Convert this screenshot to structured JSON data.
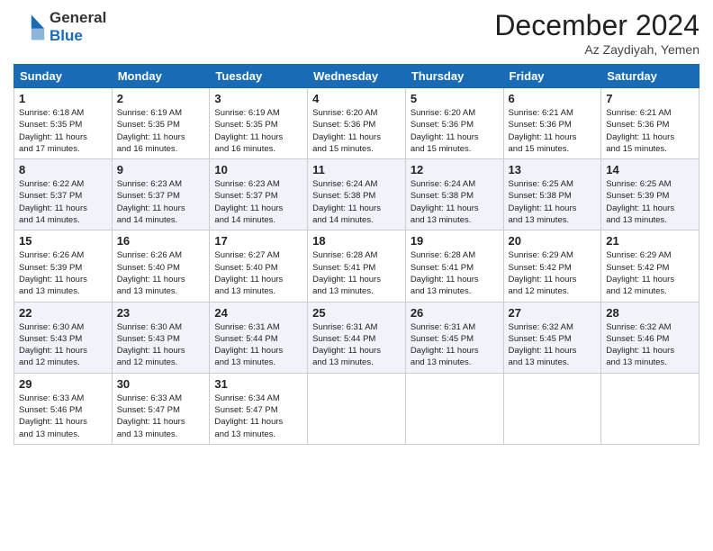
{
  "header": {
    "logo_line1": "General",
    "logo_line2": "Blue",
    "month": "December 2024",
    "location": "Az Zaydiyah, Yemen"
  },
  "weekdays": [
    "Sunday",
    "Monday",
    "Tuesday",
    "Wednesday",
    "Thursday",
    "Friday",
    "Saturday"
  ],
  "weeks": [
    [
      {
        "day": "1",
        "sunrise": "6:18 AM",
        "sunset": "5:35 PM",
        "daylight": "11 hours and 17 minutes."
      },
      {
        "day": "2",
        "sunrise": "6:19 AM",
        "sunset": "5:35 PM",
        "daylight": "11 hours and 16 minutes."
      },
      {
        "day": "3",
        "sunrise": "6:19 AM",
        "sunset": "5:35 PM",
        "daylight": "11 hours and 16 minutes."
      },
      {
        "day": "4",
        "sunrise": "6:20 AM",
        "sunset": "5:36 PM",
        "daylight": "11 hours and 15 minutes."
      },
      {
        "day": "5",
        "sunrise": "6:20 AM",
        "sunset": "5:36 PM",
        "daylight": "11 hours and 15 minutes."
      },
      {
        "day": "6",
        "sunrise": "6:21 AM",
        "sunset": "5:36 PM",
        "daylight": "11 hours and 15 minutes."
      },
      {
        "day": "7",
        "sunrise": "6:21 AM",
        "sunset": "5:36 PM",
        "daylight": "11 hours and 15 minutes."
      }
    ],
    [
      {
        "day": "8",
        "sunrise": "6:22 AM",
        "sunset": "5:37 PM",
        "daylight": "11 hours and 14 minutes."
      },
      {
        "day": "9",
        "sunrise": "6:23 AM",
        "sunset": "5:37 PM",
        "daylight": "11 hours and 14 minutes."
      },
      {
        "day": "10",
        "sunrise": "6:23 AM",
        "sunset": "5:37 PM",
        "daylight": "11 hours and 14 minutes."
      },
      {
        "day": "11",
        "sunrise": "6:24 AM",
        "sunset": "5:38 PM",
        "daylight": "11 hours and 14 minutes."
      },
      {
        "day": "12",
        "sunrise": "6:24 AM",
        "sunset": "5:38 PM",
        "daylight": "11 hours and 13 minutes."
      },
      {
        "day": "13",
        "sunrise": "6:25 AM",
        "sunset": "5:38 PM",
        "daylight": "11 hours and 13 minutes."
      },
      {
        "day": "14",
        "sunrise": "6:25 AM",
        "sunset": "5:39 PM",
        "daylight": "11 hours and 13 minutes."
      }
    ],
    [
      {
        "day": "15",
        "sunrise": "6:26 AM",
        "sunset": "5:39 PM",
        "daylight": "11 hours and 13 minutes."
      },
      {
        "day": "16",
        "sunrise": "6:26 AM",
        "sunset": "5:40 PM",
        "daylight": "11 hours and 13 minutes."
      },
      {
        "day": "17",
        "sunrise": "6:27 AM",
        "sunset": "5:40 PM",
        "daylight": "11 hours and 13 minutes."
      },
      {
        "day": "18",
        "sunrise": "6:28 AM",
        "sunset": "5:41 PM",
        "daylight": "11 hours and 13 minutes."
      },
      {
        "day": "19",
        "sunrise": "6:28 AM",
        "sunset": "5:41 PM",
        "daylight": "11 hours and 13 minutes."
      },
      {
        "day": "20",
        "sunrise": "6:29 AM",
        "sunset": "5:42 PM",
        "daylight": "11 hours and 12 minutes."
      },
      {
        "day": "21",
        "sunrise": "6:29 AM",
        "sunset": "5:42 PM",
        "daylight": "11 hours and 12 minutes."
      }
    ],
    [
      {
        "day": "22",
        "sunrise": "6:30 AM",
        "sunset": "5:43 PM",
        "daylight": "11 hours and 12 minutes."
      },
      {
        "day": "23",
        "sunrise": "6:30 AM",
        "sunset": "5:43 PM",
        "daylight": "11 hours and 12 minutes."
      },
      {
        "day": "24",
        "sunrise": "6:31 AM",
        "sunset": "5:44 PM",
        "daylight": "11 hours and 13 minutes."
      },
      {
        "day": "25",
        "sunrise": "6:31 AM",
        "sunset": "5:44 PM",
        "daylight": "11 hours and 13 minutes."
      },
      {
        "day": "26",
        "sunrise": "6:31 AM",
        "sunset": "5:45 PM",
        "daylight": "11 hours and 13 minutes."
      },
      {
        "day": "27",
        "sunrise": "6:32 AM",
        "sunset": "5:45 PM",
        "daylight": "11 hours and 13 minutes."
      },
      {
        "day": "28",
        "sunrise": "6:32 AM",
        "sunset": "5:46 PM",
        "daylight": "11 hours and 13 minutes."
      }
    ],
    [
      {
        "day": "29",
        "sunrise": "6:33 AM",
        "sunset": "5:46 PM",
        "daylight": "11 hours and 13 minutes."
      },
      {
        "day": "30",
        "sunrise": "6:33 AM",
        "sunset": "5:47 PM",
        "daylight": "11 hours and 13 minutes."
      },
      {
        "day": "31",
        "sunrise": "6:34 AM",
        "sunset": "5:47 PM",
        "daylight": "11 hours and 13 minutes."
      },
      null,
      null,
      null,
      null
    ]
  ]
}
